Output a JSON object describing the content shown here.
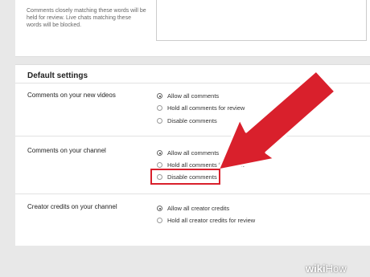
{
  "top_help": "Comments closely matching these words will be held for review. Live chats matching these words will be blocked.",
  "default_settings": {
    "title": "Default settings",
    "sections": [
      {
        "label": "Comments on your new videos",
        "options": [
          {
            "label": "Allow all comments",
            "selected": true
          },
          {
            "label": "Hold all comments for review",
            "selected": false
          },
          {
            "label": "Disable comments",
            "selected": false
          }
        ]
      },
      {
        "label": "Comments on your channel",
        "options": [
          {
            "label": "Allow all comments",
            "selected": true
          },
          {
            "label": "Hold all comments for review",
            "selected": false
          },
          {
            "label": "Disable comments",
            "selected": false
          }
        ]
      },
      {
        "label": "Creator credits on your channel",
        "options": [
          {
            "label": "Allow all creator credits",
            "selected": true
          },
          {
            "label": "Hold all creator credits for review",
            "selected": false
          }
        ]
      }
    ]
  },
  "annotation": {
    "arrow_color": "#d9202c",
    "highlight_color": "#d9202c"
  },
  "watermark": {
    "wiki": "wiki",
    "how": "How"
  }
}
